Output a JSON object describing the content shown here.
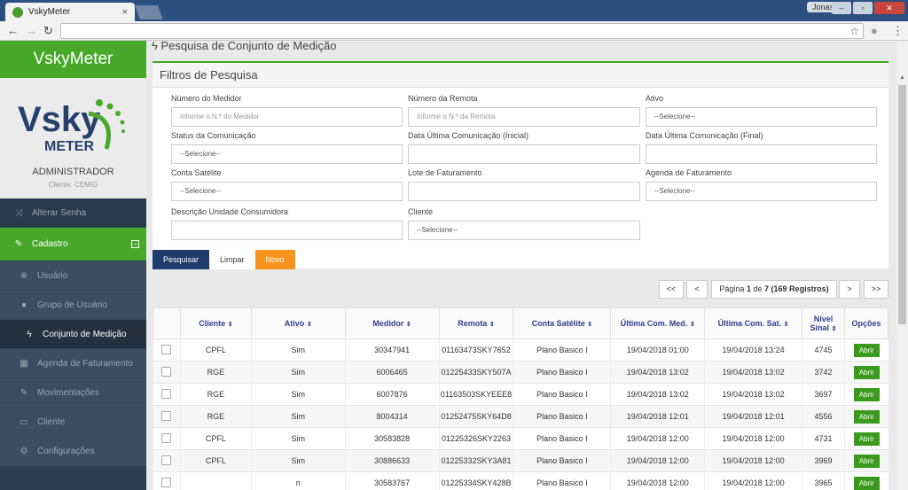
{
  "browser": {
    "tab_title": "VskyMeter",
    "user": "Jonas",
    "win_min": "–",
    "win_max": "▫",
    "win_close": "✕"
  },
  "sidebar": {
    "brand": "VskyMeter",
    "logo_text_top": "Vsky",
    "logo_text_bottom": "METER",
    "role": "ADMINISTRADOR",
    "client": "Cliente: CEMIG",
    "items": [
      {
        "label": "Alterar Senha",
        "icon": "shuffle-icon"
      },
      {
        "label": "Cadastro",
        "icon": "edit-icon"
      },
      {
        "label": "Usuário",
        "icon": "add-user-icon"
      },
      {
        "label": "Grupo de Usuário",
        "icon": "users-icon"
      },
      {
        "label": "Conjunto de Medição",
        "icon": "bolt-icon"
      },
      {
        "label": "Agenda de Faturamento",
        "icon": "grid-icon"
      },
      {
        "label": "Movimentações",
        "icon": "edit-icon"
      },
      {
        "label": "Cliente",
        "icon": "card-icon"
      },
      {
        "label": "Configurações",
        "icon": "gear-icon"
      }
    ]
  },
  "main": {
    "title": "Pesquisa de Conjunto de Medição",
    "filters": {
      "title": "Filtros de Pesquisa",
      "numero_medidor_label": "Número do Medidor",
      "numero_medidor_placeholder": "Informe o N.º do Medidor",
      "numero_remota_label": "Número da Remota",
      "numero_remota_placeholder": "Informe o N.º da Remota",
      "ativo_label": "Ativo",
      "ativo_value": "--Selecione--",
      "status_label": "Status da Comunicação",
      "status_value": "--Selecione--",
      "data_inicial_label": "Data Última Comunicação (Inicial)",
      "data_final_label": "Data Última Comunicação (Final)",
      "conta_label": "Conta Satélite",
      "conta_value": "--Selecione--",
      "lote_label": "Lote de Faturamento",
      "agenda_label": "Agenda de Faturamento",
      "agenda_value": "--Selecione--",
      "descricao_label": "Descrição Unidade Consumidora",
      "cliente_label": "Cliente",
      "cliente_value": "--Selecione--"
    },
    "buttons": {
      "pesquisar": "Pesquisar",
      "limpar": "Limpar",
      "novo": "Novo"
    },
    "pager": {
      "first": "<<",
      "prev": "<",
      "page_prefix": "Página",
      "page": "1",
      "of": "de",
      "total_pages": "7",
      "registros": "(169 Registros)",
      "next": ">",
      "last": ">>"
    },
    "table": {
      "headers": [
        "Cliente",
        "Ativo",
        "Medidor",
        "Remota",
        "Conta Satélite",
        "Última Com. Med.",
        "Última Com. Sat.",
        "Nível Sinal",
        "Opções"
      ],
      "action_label": "Abrir",
      "rows": [
        [
          "CPFL",
          "Sim",
          "30347941",
          "01163473SKY7652",
          "Plano Basico I",
          "19/04/2018 01:00",
          "19/04/2018 13:24",
          "4745"
        ],
        [
          "RGE",
          "Sim",
          "6006465",
          "01225433SKY507A",
          "Plano Basico I",
          "19/04/2018 13:02",
          "19/04/2018 13:02",
          "3742"
        ],
        [
          "RGE",
          "Sim",
          "6007876",
          "01163503SKYEEE8",
          "Plano Basico I",
          "19/04/2018 13:02",
          "19/04/2018 13:02",
          "3697"
        ],
        [
          "RGE",
          "Sim",
          "8004314",
          "01252475SKY64D8",
          "Plano Basico I",
          "19/04/2018 12:01",
          "19/04/2018 12:01",
          "4556"
        ],
        [
          "CPFL",
          "Sim",
          "30583828",
          "01225326SKY2263",
          "Plano Basico I",
          "19/04/2018 12:00",
          "19/04/2018 12:00",
          "4731"
        ],
        [
          "CPFL",
          "Sim",
          "30886633",
          "01225332SKY3A81",
          "Plano Basico I",
          "19/04/2018 12:00",
          "19/04/2018 12:00",
          "3969"
        ],
        [
          "",
          "n",
          "30583767",
          "01225334SKY428B",
          "Plano Basico I",
          "19/04/2018 12:00",
          "19/04/2018 12:00",
          "3965"
        ]
      ]
    }
  }
}
